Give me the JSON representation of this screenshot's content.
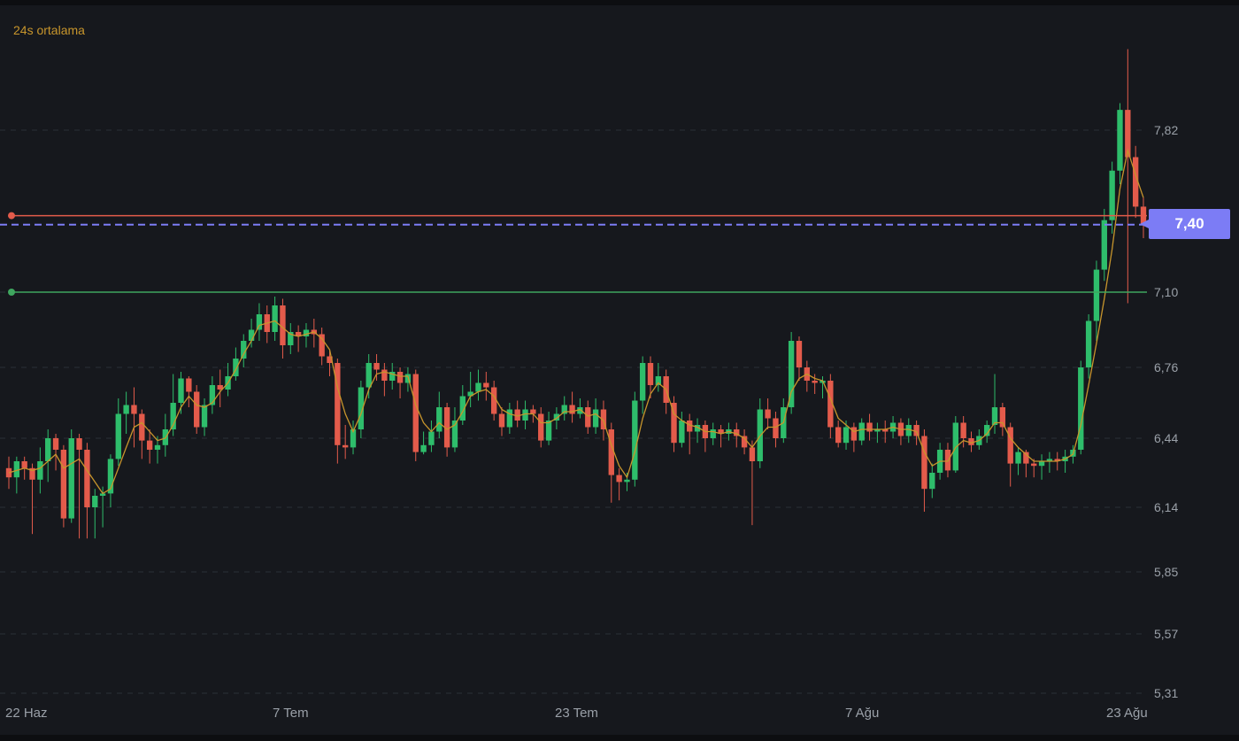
{
  "chart_data": {
    "type": "candlestick",
    "legend_label": "24s ortalama",
    "y_ticks": [
      "7,82",
      "7,10",
      "6,76",
      "6,44",
      "6,14",
      "5,85",
      "5,57",
      "5,31"
    ],
    "x_ticks": [
      "22 Haz",
      "7 Tem",
      "23 Tem",
      "7 Ağu",
      "23 Ağu"
    ],
    "current_price": "7,40",
    "current_price_value": 7.4,
    "horizontal_lines": [
      {
        "value": 7.44,
        "color": "#e35b4b",
        "style": "solid",
        "marker": true
      },
      {
        "value": 7.4,
        "color": "#7c7cf5",
        "style": "dashed",
        "marker": false
      },
      {
        "value": 7.1,
        "color": "#3fa65f",
        "style": "solid",
        "marker": true
      }
    ],
    "colors": {
      "up": "#2ebd6b",
      "down": "#e35b4b",
      "ma": "#c7952c",
      "grid": "#2b3036",
      "text": "#9aa0a8"
    },
    "candles": [
      [
        6.31,
        6.27,
        6.36,
        6.22
      ],
      [
        6.27,
        6.34,
        6.36,
        6.2
      ],
      [
        6.34,
        6.31,
        6.36,
        6.26
      ],
      [
        6.31,
        6.26,
        6.33,
        6.02
      ],
      [
        6.26,
        6.34,
        6.4,
        6.2
      ],
      [
        6.34,
        6.44,
        6.48,
        6.25
      ],
      [
        6.44,
        6.39,
        6.46,
        6.3
      ],
      [
        6.39,
        6.09,
        6.41,
        6.05
      ],
      [
        6.09,
        6.44,
        6.48,
        6.07
      ],
      [
        6.44,
        6.39,
        6.46,
        6.0
      ],
      [
        6.39,
        6.14,
        6.42,
        6.0
      ],
      [
        6.14,
        6.19,
        6.22,
        6.0
      ],
      [
        6.19,
        6.2,
        6.23,
        6.05
      ],
      [
        6.2,
        6.35,
        6.37,
        6.14
      ],
      [
        6.35,
        6.55,
        6.62,
        6.32
      ],
      [
        6.55,
        6.59,
        6.65,
        6.46
      ],
      [
        6.59,
        6.55,
        6.67,
        6.4
      ],
      [
        6.55,
        6.43,
        6.57,
        6.35
      ],
      [
        6.43,
        6.39,
        6.48,
        6.33
      ],
      [
        6.39,
        6.41,
        6.45,
        6.33
      ],
      [
        6.41,
        6.48,
        6.55,
        6.36
      ],
      [
        6.48,
        6.6,
        6.73,
        6.45
      ],
      [
        6.6,
        6.71,
        6.74,
        6.55
      ],
      [
        6.71,
        6.65,
        6.72,
        6.58
      ],
      [
        6.65,
        6.49,
        6.68,
        6.46
      ],
      [
        6.49,
        6.59,
        6.62,
        6.45
      ],
      [
        6.59,
        6.68,
        6.72,
        6.55
      ],
      [
        6.68,
        6.66,
        6.75,
        6.58
      ],
      [
        6.66,
        6.72,
        6.78,
        6.63
      ],
      [
        6.72,
        6.8,
        6.85,
        6.7
      ],
      [
        6.8,
        6.88,
        6.91,
        6.76
      ],
      [
        6.88,
        6.93,
        6.98,
        6.85
      ],
      [
        6.93,
        7.0,
        7.05,
        6.88
      ],
      [
        7.0,
        6.92,
        7.04,
        6.87
      ],
      [
        6.92,
        7.04,
        7.08,
        6.88
      ],
      [
        7.04,
        6.86,
        7.07,
        6.8
      ],
      [
        6.86,
        6.92,
        6.96,
        6.82
      ],
      [
        6.92,
        6.9,
        6.95,
        6.83
      ],
      [
        6.9,
        6.93,
        6.96,
        6.85
      ],
      [
        6.93,
        6.91,
        6.98,
        6.85
      ],
      [
        6.91,
        6.81,
        6.94,
        6.77
      ],
      [
        6.81,
        6.78,
        6.84,
        6.72
      ],
      [
        6.78,
        6.41,
        6.8,
        6.33
      ],
      [
        6.41,
        6.4,
        6.5,
        6.35
      ],
      [
        6.4,
        6.48,
        6.52,
        6.37
      ],
      [
        6.48,
        6.67,
        6.7,
        6.44
      ],
      [
        6.67,
        6.78,
        6.82,
        6.62
      ],
      [
        6.78,
        6.75,
        6.82,
        6.7
      ],
      [
        6.75,
        6.7,
        6.78,
        6.63
      ],
      [
        6.7,
        6.74,
        6.78,
        6.66
      ],
      [
        6.74,
        6.69,
        6.76,
        6.62
      ],
      [
        6.69,
        6.73,
        6.76,
        6.65
      ],
      [
        6.73,
        6.38,
        6.75,
        6.34
      ],
      [
        6.38,
        6.41,
        6.47,
        6.37
      ],
      [
        6.41,
        6.47,
        6.52,
        6.38
      ],
      [
        6.47,
        6.58,
        6.65,
        6.44
      ],
      [
        6.58,
        6.4,
        6.6,
        6.36
      ],
      [
        6.4,
        6.52,
        6.58,
        6.38
      ],
      [
        6.52,
        6.63,
        6.68,
        6.5
      ],
      [
        6.63,
        6.65,
        6.74,
        6.58
      ],
      [
        6.65,
        6.69,
        6.75,
        6.61
      ],
      [
        6.69,
        6.67,
        6.74,
        6.61
      ],
      [
        6.67,
        6.55,
        6.7,
        6.52
      ],
      [
        6.55,
        6.49,
        6.58,
        6.45
      ],
      [
        6.49,
        6.57,
        6.6,
        6.46
      ],
      [
        6.57,
        6.52,
        6.61,
        6.49
      ],
      [
        6.52,
        6.57,
        6.61,
        6.48
      ],
      [
        6.57,
        6.55,
        6.59,
        6.51
      ],
      [
        6.55,
        6.43,
        6.58,
        6.4
      ],
      [
        6.43,
        6.52,
        6.56,
        6.41
      ],
      [
        6.52,
        6.55,
        6.58,
        6.48
      ],
      [
        6.55,
        6.59,
        6.63,
        6.52
      ],
      [
        6.59,
        6.55,
        6.65,
        6.51
      ],
      [
        6.55,
        6.58,
        6.62,
        6.53
      ],
      [
        6.58,
        6.49,
        6.61,
        6.46
      ],
      [
        6.49,
        6.57,
        6.62,
        6.46
      ],
      [
        6.57,
        6.48,
        6.61,
        6.43
      ],
      [
        6.48,
        6.28,
        6.51,
        6.16
      ],
      [
        6.28,
        6.25,
        6.31,
        6.17
      ],
      [
        6.25,
        6.26,
        6.29,
        6.21
      ],
      [
        6.26,
        6.61,
        6.65,
        6.23
      ],
      [
        6.61,
        6.78,
        6.81,
        6.55
      ],
      [
        6.78,
        6.68,
        6.81,
        6.62
      ],
      [
        6.68,
        6.72,
        6.78,
        6.65
      ],
      [
        6.72,
        6.6,
        6.75,
        6.55
      ],
      [
        6.6,
        6.42,
        6.63,
        6.38
      ],
      [
        6.42,
        6.52,
        6.56,
        6.4
      ],
      [
        6.52,
        6.47,
        6.55,
        6.37
      ],
      [
        6.47,
        6.5,
        6.53,
        6.42
      ],
      [
        6.5,
        6.44,
        6.52,
        6.38
      ],
      [
        6.44,
        6.48,
        6.51,
        6.41
      ],
      [
        6.48,
        6.46,
        6.5,
        6.4
      ],
      [
        6.46,
        6.48,
        6.51,
        6.43
      ],
      [
        6.48,
        6.45,
        6.51,
        6.4
      ],
      [
        6.45,
        6.4,
        6.48,
        6.37
      ],
      [
        6.4,
        6.34,
        6.43,
        6.06
      ],
      [
        6.34,
        6.57,
        6.62,
        6.31
      ],
      [
        6.57,
        6.53,
        6.62,
        6.48
      ],
      [
        6.53,
        6.44,
        6.56,
        6.4
      ],
      [
        6.44,
        6.58,
        6.62,
        6.42
      ],
      [
        6.58,
        6.88,
        6.92,
        6.55
      ],
      [
        6.88,
        6.76,
        6.9,
        6.7
      ],
      [
        6.76,
        6.7,
        6.79,
        6.65
      ],
      [
        6.7,
        6.69,
        6.73,
        6.64
      ],
      [
        6.69,
        6.7,
        6.72,
        6.62
      ],
      [
        6.7,
        6.49,
        6.73,
        6.44
      ],
      [
        6.49,
        6.42,
        6.52,
        6.4
      ],
      [
        6.42,
        6.49,
        6.52,
        6.39
      ],
      [
        6.49,
        6.43,
        6.51,
        6.38
      ],
      [
        6.43,
        6.51,
        6.53,
        6.41
      ],
      [
        6.51,
        6.47,
        6.55,
        6.43
      ],
      [
        6.47,
        6.48,
        6.51,
        6.42
      ],
      [
        6.48,
        6.47,
        6.52,
        6.42
      ],
      [
        6.47,
        6.51,
        6.54,
        6.44
      ],
      [
        6.51,
        6.45,
        6.53,
        6.41
      ],
      [
        6.45,
        6.5,
        6.53,
        6.42
      ],
      [
        6.5,
        6.45,
        6.52,
        6.41
      ],
      [
        6.45,
        6.22,
        6.48,
        6.12
      ],
      [
        6.22,
        6.29,
        6.33,
        6.18
      ],
      [
        6.29,
        6.39,
        6.42,
        6.26
      ],
      [
        6.39,
        6.3,
        6.42,
        6.27
      ],
      [
        6.3,
        6.51,
        6.54,
        6.29
      ],
      [
        6.51,
        6.44,
        6.54,
        6.4
      ],
      [
        6.44,
        6.41,
        6.47,
        6.38
      ],
      [
        6.41,
        6.45,
        6.48,
        6.39
      ],
      [
        6.45,
        6.5,
        6.52,
        6.42
      ],
      [
        6.5,
        6.58,
        6.73,
        6.46
      ],
      [
        6.58,
        6.49,
        6.6,
        6.45
      ],
      [
        6.49,
        6.33,
        6.51,
        6.23
      ],
      [
        6.33,
        6.38,
        6.4,
        6.28
      ],
      [
        6.38,
        6.33,
        6.39,
        6.27
      ],
      [
        6.33,
        6.32,
        6.35,
        6.27
      ],
      [
        6.32,
        6.34,
        6.37,
        6.26
      ],
      [
        6.34,
        6.35,
        6.38,
        6.29
      ],
      [
        6.35,
        6.34,
        6.38,
        6.3
      ],
      [
        6.34,
        6.36,
        6.39,
        6.29
      ],
      [
        6.36,
        6.39,
        6.41,
        6.33
      ],
      [
        6.39,
        6.76,
        6.79,
        6.37
      ],
      [
        6.76,
        6.97,
        7.0,
        6.71
      ],
      [
        6.97,
        7.2,
        7.24,
        6.88
      ],
      [
        7.2,
        7.42,
        7.47,
        7.15
      ],
      [
        7.42,
        7.64,
        7.68,
        7.36
      ],
      [
        7.64,
        7.91,
        7.94,
        7.58
      ],
      [
        7.91,
        7.7,
        8.18,
        7.05
      ],
      [
        7.7,
        7.48,
        7.75,
        7.43
      ],
      [
        7.48,
        7.4,
        7.52,
        7.34
      ]
    ],
    "moving_average": [
      6.29,
      6.3,
      6.31,
      6.3,
      6.31,
      6.34,
      6.37,
      6.31,
      6.33,
      6.35,
      6.3,
      6.25,
      6.2,
      6.22,
      6.31,
      6.4,
      6.49,
      6.51,
      6.47,
      6.43,
      6.44,
      6.5,
      6.58,
      6.63,
      6.59,
      6.58,
      6.6,
      6.65,
      6.69,
      6.75,
      6.82,
      6.88,
      6.95,
      6.96,
      6.97,
      6.94,
      6.91,
      6.9,
      6.91,
      6.92,
      6.89,
      6.84,
      6.67,
      6.55,
      6.47,
      6.55,
      6.66,
      6.73,
      6.74,
      6.73,
      6.72,
      6.72,
      6.59,
      6.51,
      6.47,
      6.51,
      6.48,
      6.5,
      6.56,
      6.63,
      6.65,
      6.66,
      6.63,
      6.57,
      6.55,
      6.54,
      6.55,
      6.55,
      6.51,
      6.51,
      6.53,
      6.56,
      6.56,
      6.57,
      6.54,
      6.55,
      6.52,
      6.41,
      6.32,
      6.27,
      6.38,
      6.53,
      6.64,
      6.69,
      6.66,
      6.55,
      6.52,
      6.5,
      6.49,
      6.47,
      6.47,
      6.46,
      6.47,
      6.46,
      6.44,
      6.4,
      6.45,
      6.49,
      6.49,
      6.51,
      6.65,
      6.71,
      6.73,
      6.71,
      6.7,
      6.62,
      6.53,
      6.5,
      6.47,
      6.48,
      6.48,
      6.48,
      6.48,
      6.49,
      6.48,
      6.48,
      6.47,
      6.38,
      6.32,
      6.34,
      6.34,
      6.4,
      6.43,
      6.42,
      6.43,
      6.46,
      6.51,
      6.51,
      6.44,
      6.4,
      6.37,
      6.34,
      6.34,
      6.34,
      6.34,
      6.35,
      6.37,
      6.5,
      6.68,
      6.87,
      7.07,
      7.29,
      7.56,
      7.73,
      7.62,
      7.52
    ]
  }
}
